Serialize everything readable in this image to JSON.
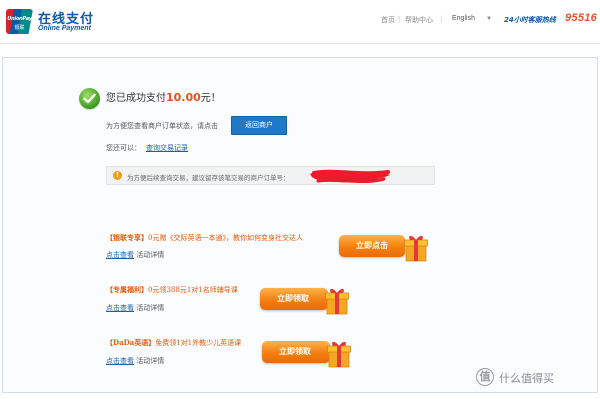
{
  "header": {
    "logo_badge_top": "UnionPay",
    "logo_badge_bottom": "银联",
    "logo_title": "在线支付",
    "logo_subtitle": "Online Payment",
    "nav": {
      "home": "首页",
      "separator": "|",
      "help": "帮助中心"
    },
    "language": {
      "selected": "English"
    },
    "hotline_label": "24小时客服热线",
    "hotline_number": "95516"
  },
  "success": {
    "message_prefix": "您已成功支付",
    "amount": "10.00",
    "message_suffix": "元！",
    "status_hint": "为方便您查看商户订单状态，请点击",
    "return_button": "返回商户",
    "also_label": "您还可以：",
    "history_link": "查询交易记录",
    "notice_icon": "!",
    "notice_text": "为方便后续查询交易，建议留存该笔交易的商户订单号："
  },
  "promotions": [
    {
      "tag": "【银联专享】",
      "title": "0元赠《交际英语一本通》，教你如何变身社交达人",
      "detail_link": "点击查看",
      "detail_text": "活动详情",
      "button": "立即点击"
    },
    {
      "tag": "【专属福利】",
      "title": "0元领388元1对1名师辅导课",
      "detail_link": "点击查看",
      "detail_text": "活动详情",
      "button": "立即领取"
    },
    {
      "tag": "【DaDa英语】",
      "title": "免费领1对1外教少儿英语课",
      "detail_link": "点击查看",
      "detail_text": "活动详情",
      "button": "立即领取"
    }
  ],
  "watermark": {
    "symbol": "值",
    "text": "什么值得买"
  },
  "colors": {
    "brand_blue": "#0d5aa7",
    "accent_orange": "#e6501a",
    "button_blue": "#1f78c8"
  }
}
